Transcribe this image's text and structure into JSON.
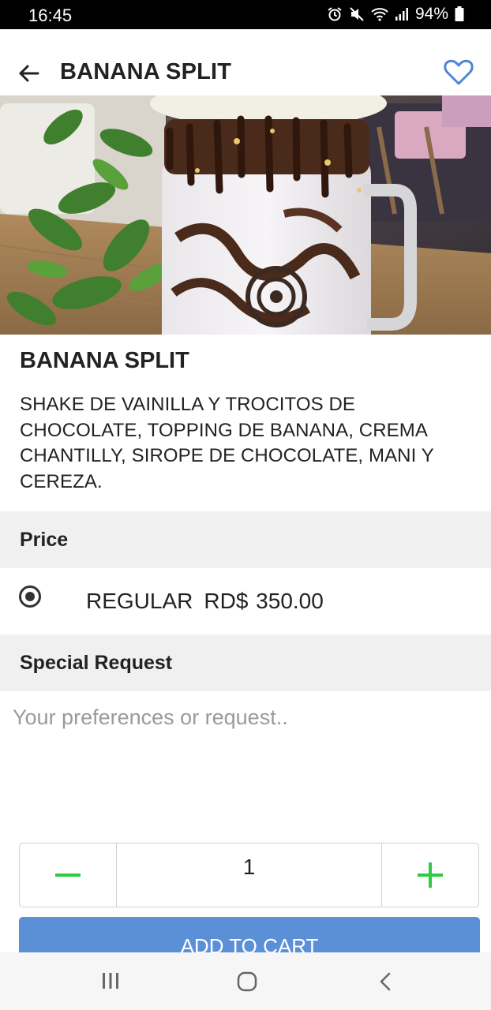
{
  "status_bar": {
    "time": "16:45",
    "battery": "94%"
  },
  "header": {
    "title": "BANANA SPLIT"
  },
  "item": {
    "name": "BANANA SPLIT",
    "description": "SHAKE DE VAINILLA Y TROCITOS DE CHOCOLATE, TOPPING DE BANANA, CREMA CHANTILLY, SIROPE DE CHOCOLATE, MANI Y CEREZA."
  },
  "price_section": {
    "label": "Price",
    "options": [
      {
        "size": "REGULAR",
        "price": "RD$ 350.00",
        "selected": true
      }
    ]
  },
  "special_request": {
    "label": "Special Request",
    "value": "",
    "placeholder": "Your preferences or request.."
  },
  "quantity": {
    "value": "1"
  },
  "add_to_cart": {
    "label": "ADD TO CART"
  },
  "colors": {
    "accent_blue": "#5b8fd6",
    "stepper_green": "#2ecc40",
    "section_bg": "#f0f0f0"
  }
}
